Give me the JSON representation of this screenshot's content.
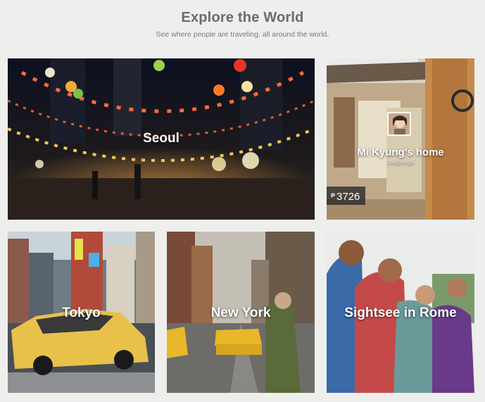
{
  "header": {
    "title": "Explore the World",
    "subtitle": "See where people are traveling, all around the world."
  },
  "tiles": {
    "seoul": {
      "label": "Seoul"
    },
    "home": {
      "host_name": "Mi Kyung's home",
      "location": "Jongno-gu",
      "currency_symbol": "₱",
      "price": "3726"
    },
    "tokyo": {
      "label": "Tokyo"
    },
    "newyork": {
      "label": "New York"
    },
    "rome": {
      "label": "Sightsee in Rome"
    }
  },
  "colors": {
    "background": "#eeeeed",
    "title": "#6b6b6b",
    "subtitle": "#7a7a7a"
  }
}
